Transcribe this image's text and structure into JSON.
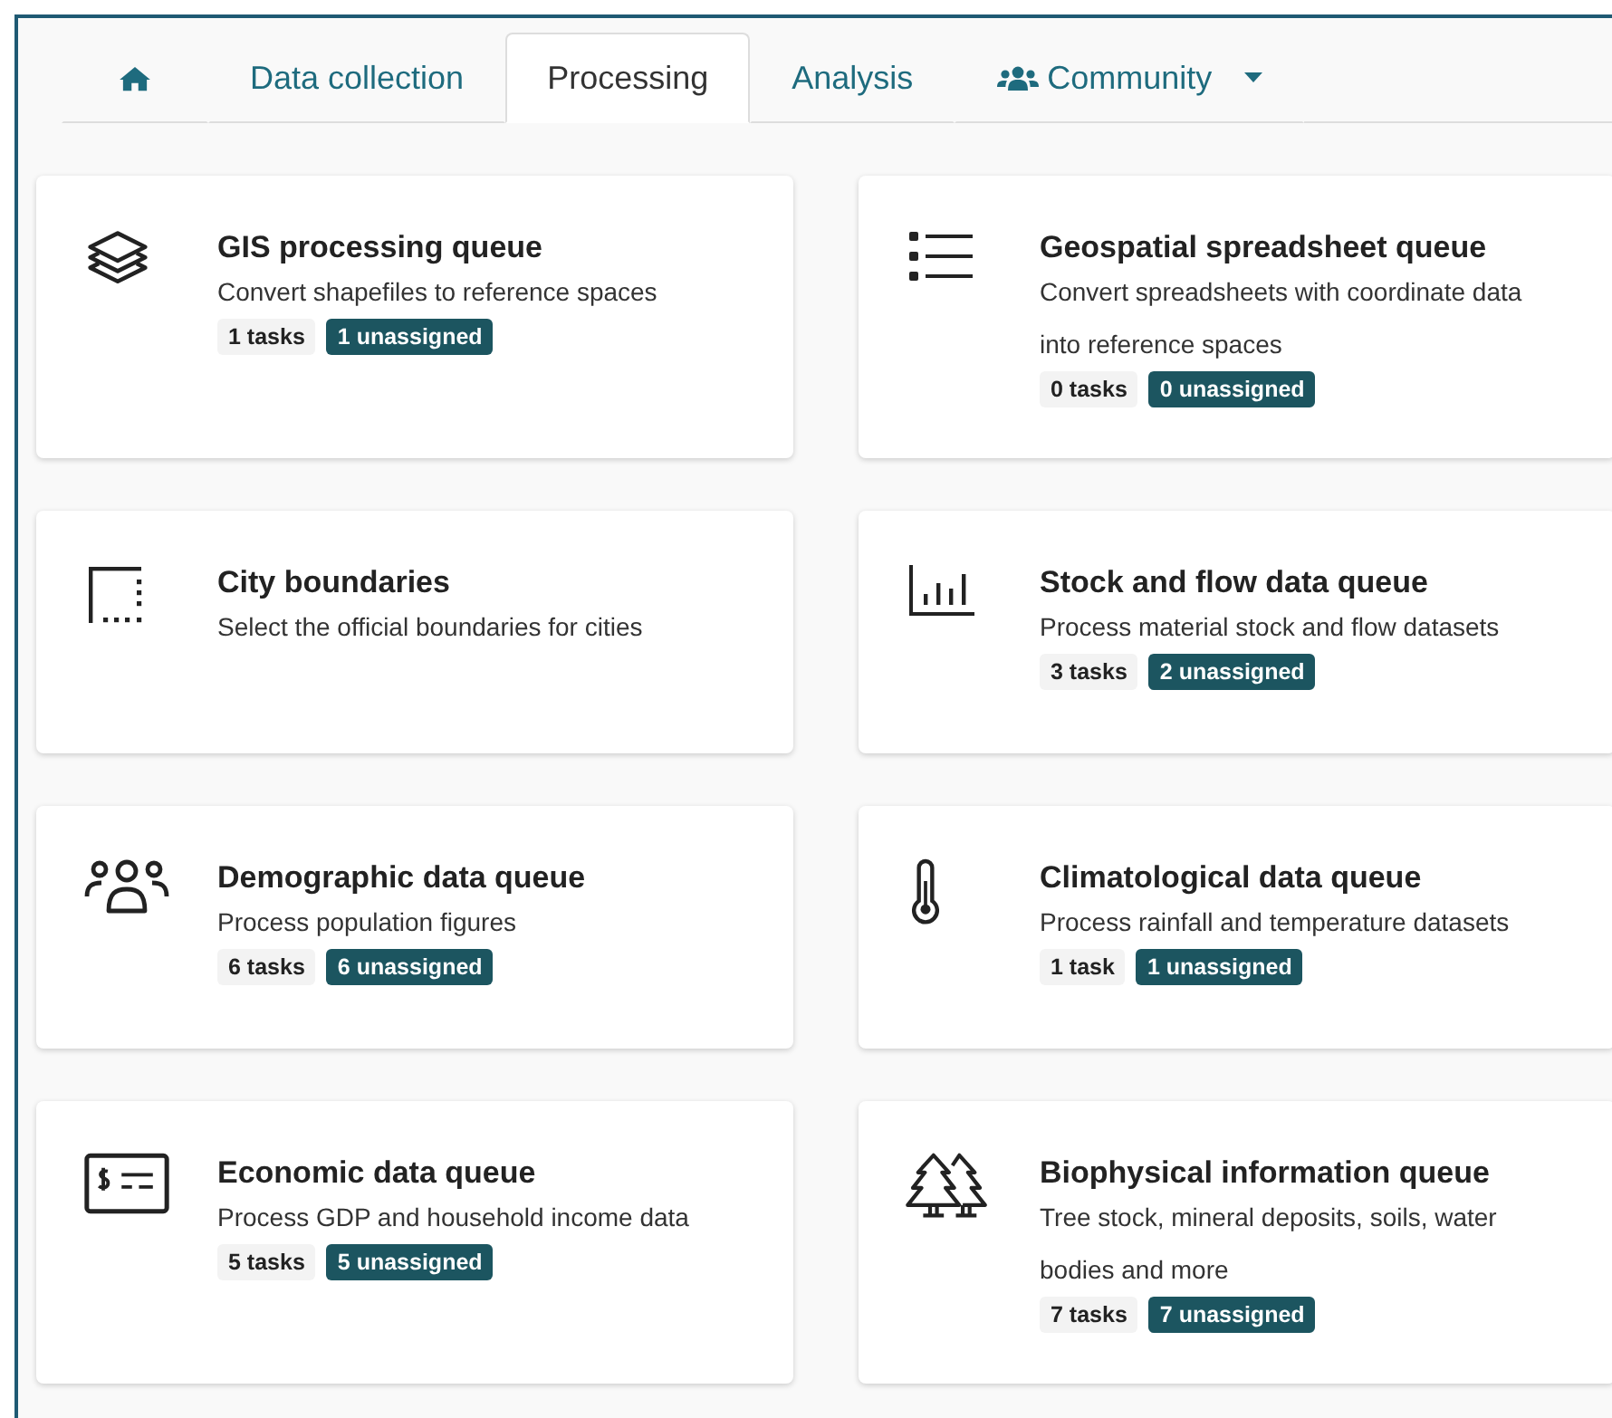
{
  "tabs": [
    {
      "kind": "home",
      "selected": false
    },
    {
      "kind": "text",
      "label": "Data collection",
      "selected": false
    },
    {
      "kind": "text",
      "label": "Processing",
      "selected": true
    },
    {
      "kind": "text",
      "label": "Analysis",
      "selected": false
    },
    {
      "kind": "dropdown",
      "label": "Community",
      "selected": false
    }
  ],
  "cards": [
    {
      "title": "GIS processing queue",
      "description": "Convert shapefiles to reference spaces",
      "tasks": "1 tasks",
      "unassigned": "1 unassigned"
    },
    {
      "title": "Geospatial spreadsheet queue",
      "description": "Convert spreadsheets with coordinate data into reference spaces",
      "tasks": "0 tasks",
      "unassigned": "0 unassigned"
    },
    {
      "title": "City boundaries",
      "description": "Select the official boundaries for cities"
    },
    {
      "title": "Stock and flow data queue",
      "description": "Process material stock and flow datasets",
      "tasks": "3 tasks",
      "unassigned": "2 unassigned"
    },
    {
      "title": "Demographic data queue",
      "description": "Process population figures",
      "tasks": "6 tasks",
      "unassigned": "6 unassigned"
    },
    {
      "title": "Climatological data queue",
      "description": "Process rainfall and temperature datasets",
      "tasks": "1 task",
      "unassigned": "1 unassigned"
    },
    {
      "title": "Economic data queue",
      "description": "Process GDP and household income data",
      "tasks": "5 tasks",
      "unassigned": "5 unassigned"
    },
    {
      "title": "Biophysical information queue",
      "description": "Tree stock, mineral deposits, soils, water bodies and more",
      "tasks": "7 tasks",
      "unassigned": "7 unassigned"
    }
  ]
}
